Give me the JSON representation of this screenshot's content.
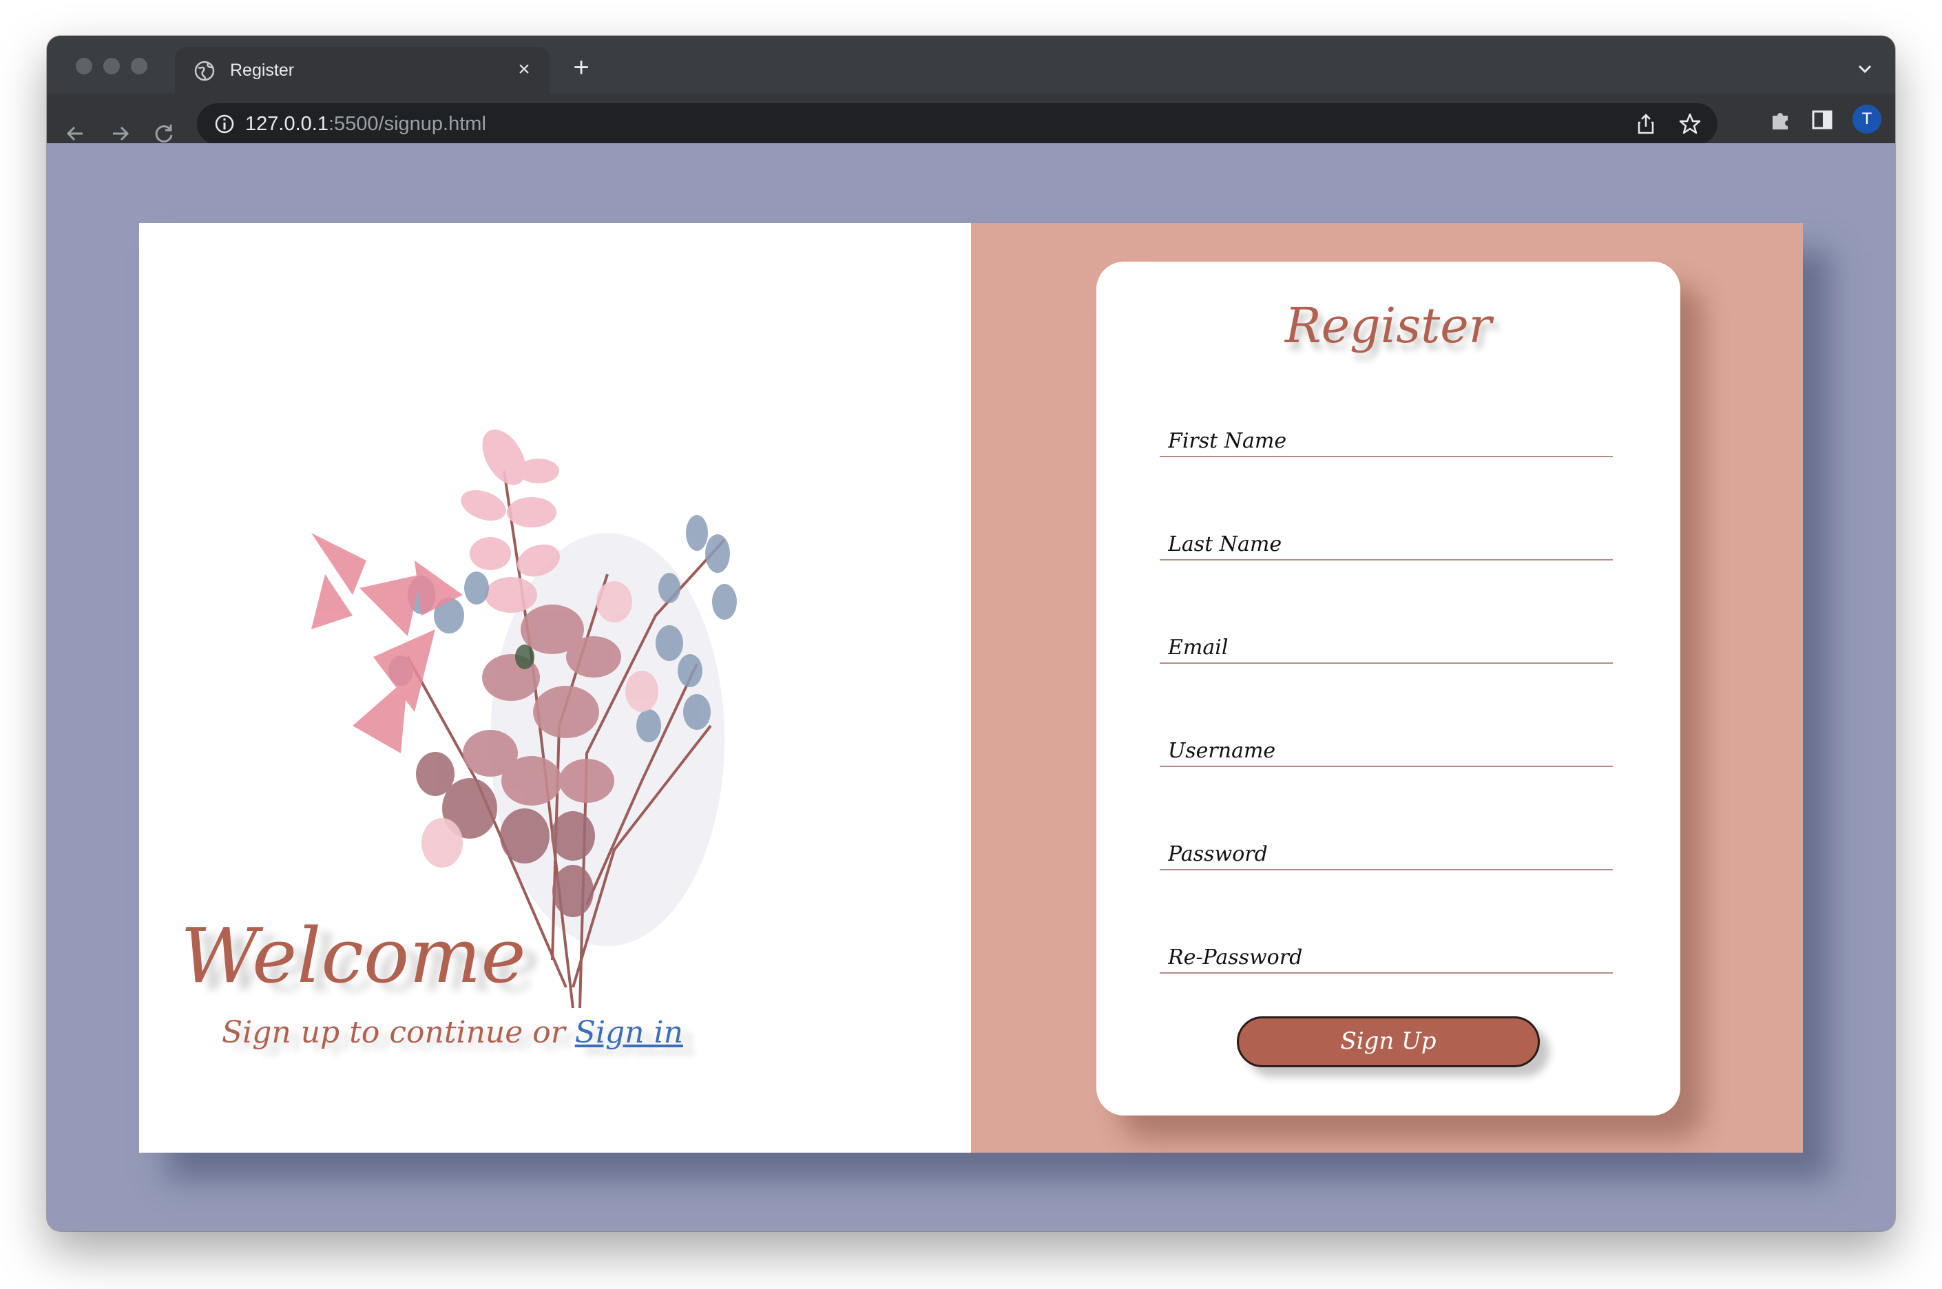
{
  "browser": {
    "tab_title": "Register",
    "tab_close": "×",
    "new_tab": "+",
    "url_host": "127.0.0.1",
    "url_rest": ":5500/signup.html",
    "avatar_letter": "T"
  },
  "left": {
    "welcome": "Welcome",
    "subline_text": "Sign up to continue or ",
    "signin_link": "Sign in"
  },
  "form": {
    "title": "Register",
    "fields": [
      {
        "placeholder": "First Name",
        "value": ""
      },
      {
        "placeholder": "Last Name",
        "value": ""
      },
      {
        "placeholder": "Email",
        "value": ""
      },
      {
        "placeholder": "Username",
        "value": ""
      },
      {
        "placeholder": "Password",
        "value": ""
      },
      {
        "placeholder": "Re-Password",
        "value": ""
      }
    ],
    "submit_label": "Sign Up"
  },
  "colors": {
    "page_bg": "#949ab7",
    "panel_right": "#dba597",
    "accent": "#b06150",
    "link": "#3c6db8"
  }
}
